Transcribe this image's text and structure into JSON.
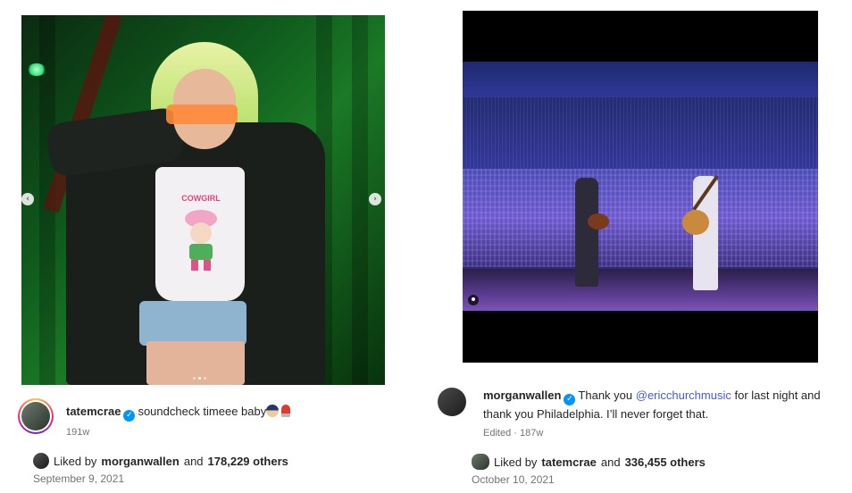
{
  "post_left": {
    "username": "tatemcrae",
    "caption": "soundcheck timeee baby",
    "caption_emojis": [
      "police-officer-emoji",
      "siren-emoji"
    ],
    "age": "191w",
    "liked_by_prefix": "Liked by",
    "liked_by_user": "morganwallen",
    "liked_by_and": "and",
    "liked_by_count": "178,229 others",
    "date": "September 9, 2021",
    "carousel_prev": "‹",
    "carousel_next": "›",
    "carousel_slide_count": 3,
    "carousel_active_index": 1,
    "shirt_text": "COWGIRL"
  },
  "post_right": {
    "username": "morganwallen",
    "caption_start": "Thank you",
    "mention": "@ericchurchmusic",
    "caption_end": "for last night and thank you Philadelphia. I’ll never forget that.",
    "meta": "Edited · 187w",
    "liked_by_prefix": "Liked by",
    "liked_by_user": "tatemcrae",
    "liked_by_and": "and",
    "liked_by_count": "336,455 others",
    "date": "October 10, 2021"
  },
  "colors": {
    "verified": "#0095f6",
    "mention": "#4a5ad1",
    "secondary_text": "#737373"
  }
}
